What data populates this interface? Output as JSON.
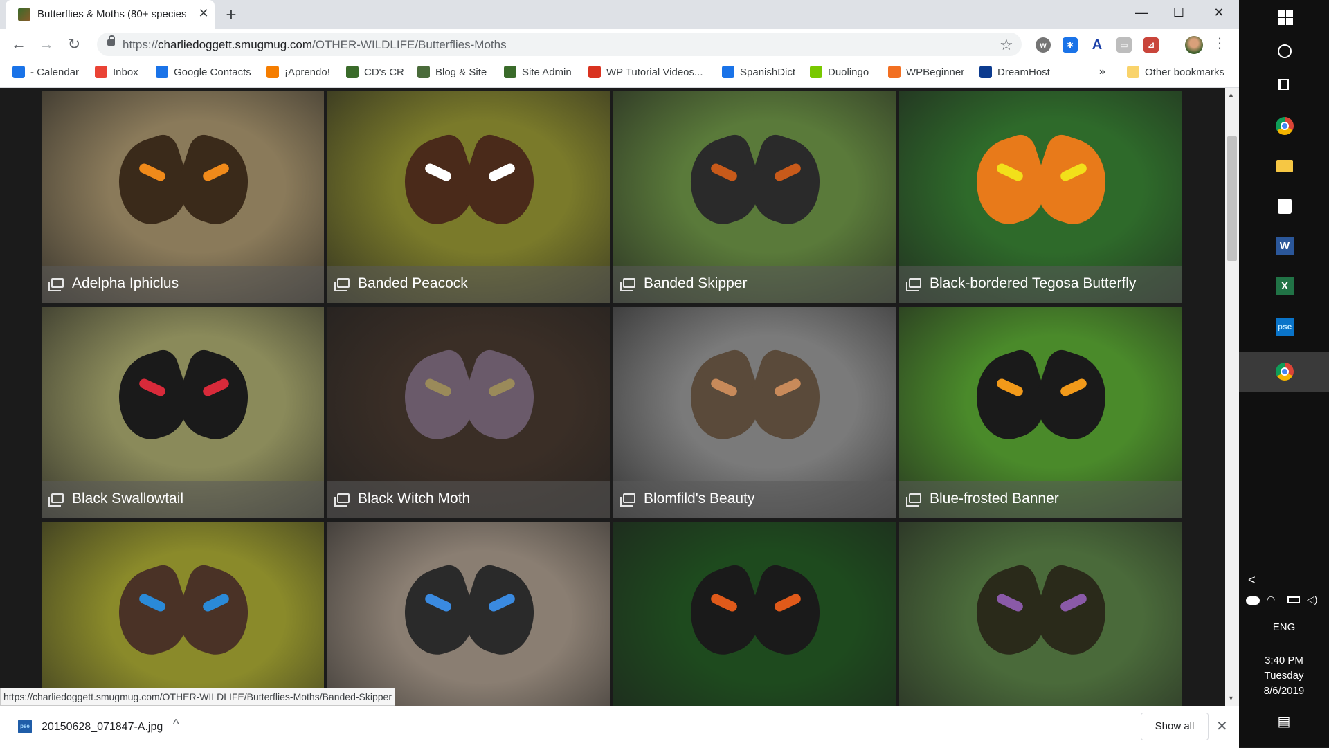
{
  "tab": {
    "title": "Butterflies & Moths (80+ species",
    "close": "✕"
  },
  "new_tab": "+",
  "window_controls": {
    "minimize": "—",
    "maximize": "☐",
    "close": "✕"
  },
  "nav": {
    "back": "←",
    "forward": "→",
    "reload": "↻"
  },
  "address": {
    "scheme": "https://",
    "host": "charliedoggett.smugmug.com",
    "path": "/OTHER-WILDLIFE/Butterflies-Moths"
  },
  "toolbar_icons": {
    "star": "☆",
    "menu": "⋮"
  },
  "extensions": [
    "w-extension",
    "snowflake-extension",
    "a-extension",
    "cast-extension",
    "pdf-extension"
  ],
  "bookmarks": [
    {
      "label": "- Calendar",
      "icon": "calendar-icon",
      "color": "#1a73e8"
    },
    {
      "label": "Inbox",
      "icon": "gmail-icon",
      "color": "#ea4335"
    },
    {
      "label": "Google Contacts",
      "icon": "contacts-icon",
      "color": "#1a73e8"
    },
    {
      "label": "¡Aprendo!",
      "icon": "blogger-icon",
      "color": "#f57d00"
    },
    {
      "label": "CD's CR",
      "icon": "photo-icon",
      "color": "#3a6b2a"
    },
    {
      "label": "Blog & Site",
      "icon": "photo-icon",
      "color": "#4a6b3a"
    },
    {
      "label": "Site Admin",
      "icon": "photo-icon",
      "color": "#3a6b2a"
    },
    {
      "label": "WP Tutorial Videos...",
      "icon": "wp101-icon",
      "color": "#d9321f"
    },
    {
      "label": "SpanishDict",
      "icon": "spanishdict-icon",
      "color": "#1a73e8"
    },
    {
      "label": "Duolingo",
      "icon": "duolingo-icon",
      "color": "#78c800"
    },
    {
      "label": "WPBeginner",
      "icon": "wpbeginner-icon",
      "color": "#f26f21"
    },
    {
      "label": "DreamHost",
      "icon": "dreamhost-icon",
      "color": "#0c3b8f"
    }
  ],
  "bookmarks_overflow": "»",
  "other_bookmarks": "Other bookmarks",
  "gallery": [
    {
      "label": "Adelpha Iphiclus",
      "bg": "#8a7a5a",
      "fg": "#3a2a1a",
      "accent": "#f08a1a"
    },
    {
      "label": "Banded Peacock",
      "bg": "#7a7a2a",
      "fg": "#4a2a1a",
      "accent": "#ffffff"
    },
    {
      "label": "Banded Skipper",
      "bg": "#5a7a3a",
      "fg": "#2a2a2a",
      "accent": "#c85a1a"
    },
    {
      "label": "Black-bordered Tegosa Butterfly",
      "bg": "#2e6a2a",
      "fg": "#e87a1a",
      "accent": "#f2e01a"
    },
    {
      "label": "Black Swallowtail",
      "bg": "#8a8a5a",
      "fg": "#1a1a1a",
      "accent": "#d82a3a"
    },
    {
      "label": "Black Witch Moth",
      "bg": "#3a2e26",
      "fg": "#6a5a6a",
      "accent": "#9a8a5a"
    },
    {
      "label": "Blomfild's Beauty",
      "bg": "#7a7a7a",
      "fg": "#5a4a3a",
      "accent": "#c88a5a"
    },
    {
      "label": "Blue-frosted Banner",
      "bg": "#4a8a2a",
      "fg": "#1a1a1a",
      "accent": "#f29a1a"
    },
    {
      "label": "",
      "bg": "#8a8a2a",
      "fg": "#4a3226",
      "accent": "#2a8ad8"
    },
    {
      "label": "",
      "bg": "#8a7e72",
      "fg": "#2a2a2a",
      "accent": "#3a8ae0"
    },
    {
      "label": "",
      "bg": "#1e4a1e",
      "fg": "#1a1a1a",
      "accent": "#e05a1a"
    },
    {
      "label": "",
      "bg": "#4a6a3a",
      "fg": "#2a2a1a",
      "accent": "#8a5aa8"
    }
  ],
  "status_url": "https://charliedoggett.smugmug.com/OTHER-WILDLIFE/Butterflies-Moths/Banded-Skipper",
  "download": {
    "filename": "20150628_071847-A.jpg",
    "icon_text": "pse",
    "chevron": "^",
    "show_all": "Show all",
    "close": "✕"
  },
  "taskbar": {
    "icons": [
      "windows-start-icon",
      "cortana-icon",
      "task-view-icon",
      "chrome-icon",
      "file-explorer-icon",
      "solitaire-icon",
      "word-icon",
      "excel-icon",
      "photoshop-elements-icon",
      "chrome-icon"
    ],
    "word_label": "W",
    "excel_label": "X",
    "pse_label": "pse",
    "tray_chevron": "<",
    "language": "ENG",
    "time": "3:40 PM",
    "day": "Tuesday",
    "date": "8/6/2019",
    "notifications": "▤"
  }
}
